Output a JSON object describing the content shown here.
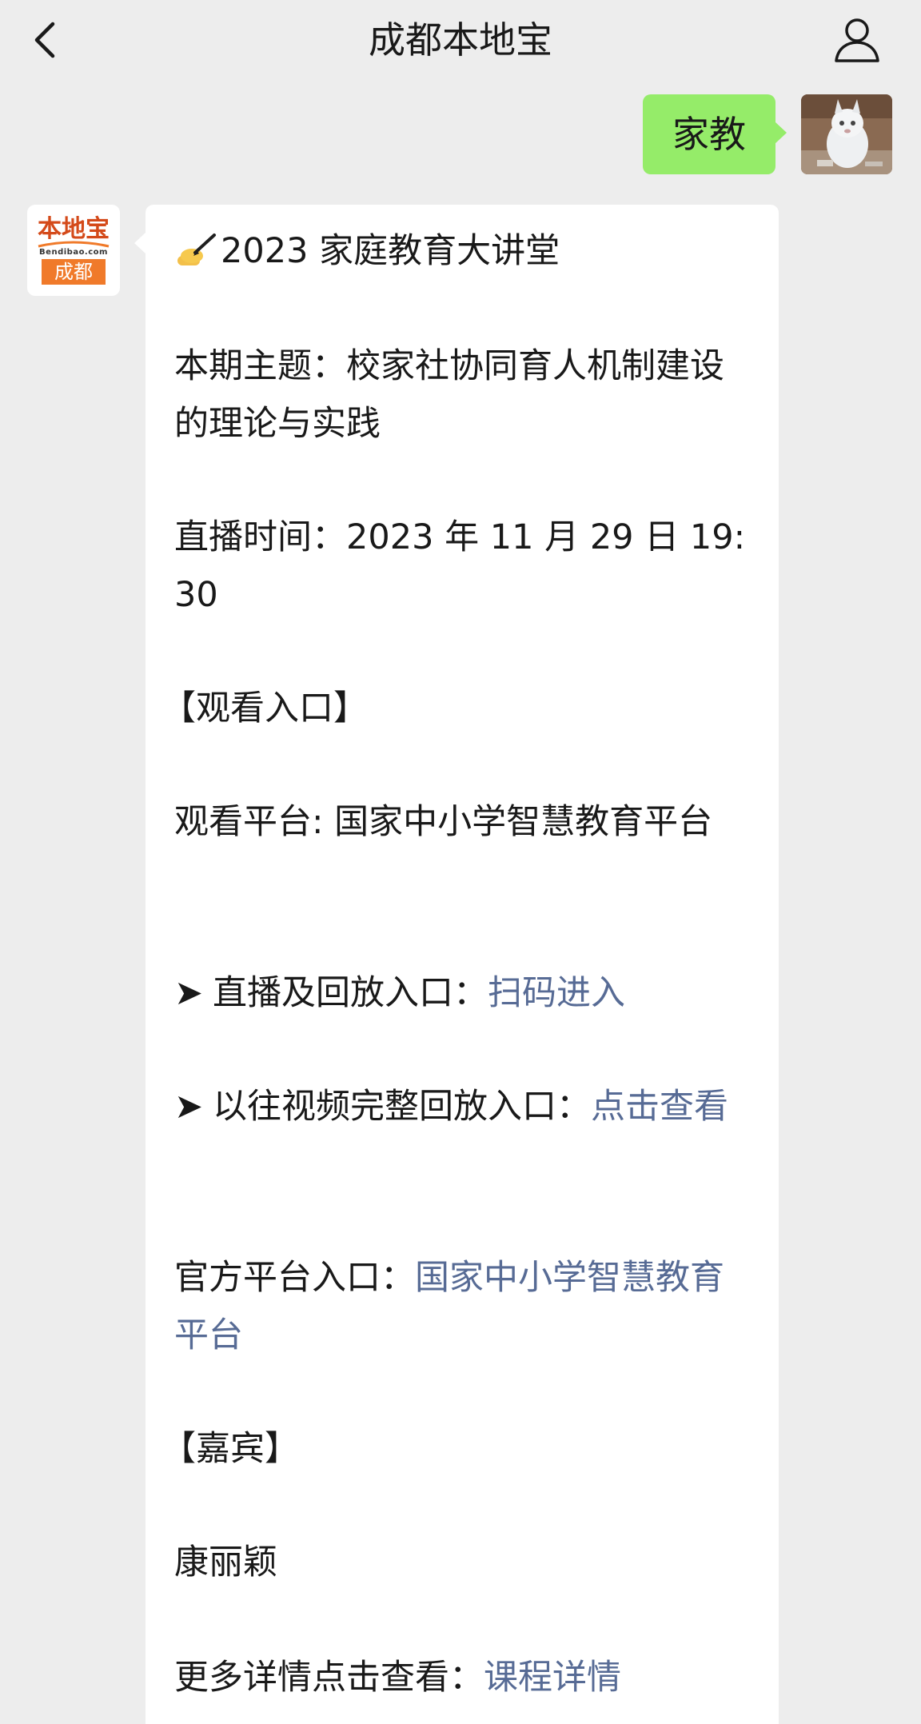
{
  "header": {
    "title": "成都本地宝"
  },
  "outgoing": {
    "text": "家教"
  },
  "bot": {
    "logo_top": "本地宝",
    "logo_domain": "Bendibao.com",
    "logo_city": "成都"
  },
  "message": {
    "heading_emoji": "✍",
    "heading": "2023 家庭教育大讲堂",
    "topic": "本期主题：校家社协同育人机制建设的理论与实践",
    "live_time": "直播时间：2023 年 11 月 29 日 19:30",
    "watch_section": "【观看入口】",
    "platform": "观看平台: 国家中小学智慧教育平台",
    "arrow_symbol": "➤",
    "live_replay_label": "直播及回放入口：",
    "live_replay_link": "扫码进入",
    "past_video_label": "以往视频完整回放入口：",
    "past_video_link": "点击查看",
    "official_label": "官方平台入口：",
    "official_link": "国家中小学智慧教育平台",
    "guest_section": "【嘉宾】",
    "guest_name": "康丽颖",
    "more_label": "更多详情点击查看：",
    "more_link": "课程详情"
  },
  "colors": {
    "background": "#ededed",
    "outgoing_bubble": "#95ec69",
    "incoming_bubble": "#ffffff",
    "link": "#576b95",
    "logo_orange": "#f07a2a"
  },
  "icons": {
    "back": "chevron-left-icon",
    "profile": "person-outline-icon",
    "pen": "writing-hand-icon"
  }
}
